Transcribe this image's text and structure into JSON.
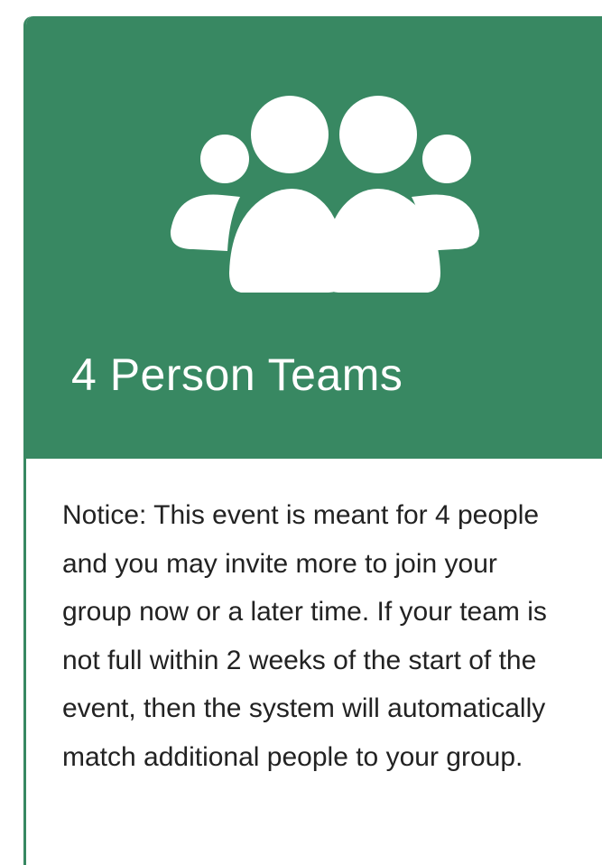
{
  "card": {
    "title": "4 Person Teams",
    "icon": "group-of-people-icon",
    "notice": "Notice: This event is meant for 4 people and you may invite more to join your group now or a later time. If your team is not full within 2 weeks of the start of the event, then the system will automatically match additional people to your group."
  },
  "colors": {
    "header_background": "#388862",
    "icon_fill": "#ffffff",
    "title_text": "#ffffff",
    "body_text": "#222222"
  }
}
